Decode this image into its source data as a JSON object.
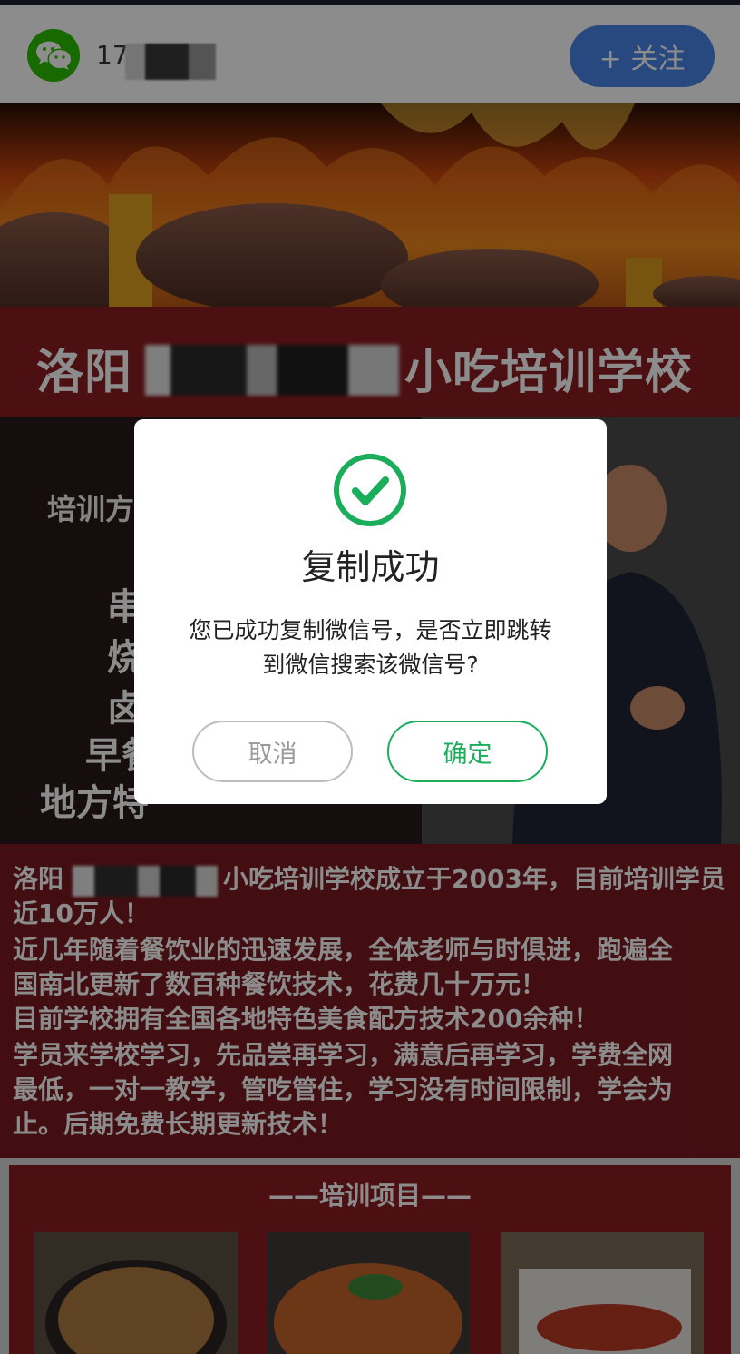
{
  "header": {
    "account_prefix": "17",
    "follow_label": "+ 关注"
  },
  "page": {
    "title_left": "洛阳",
    "title_right": "小吃培训学校",
    "mid_label": "培训方",
    "mid_lines": [
      "串",
      "烧",
      "卤",
      "早餐",
      "地方特"
    ],
    "description": [
      {
        "text_left": "洛阳",
        "text_right": "小吃培训学校成立于2003年，目前培训学员"
      },
      {
        "text": "近10万人！"
      },
      {
        "text": "近几年随着餐饮业的迅速发展，全体老师与时俱进，跑遍全"
      },
      {
        "text": "国南北更新了数百种餐饮技术，花费几十万元！"
      },
      {
        "text": "目前学校拥有全国各地特色美食配方技术200余种！"
      },
      {
        "text": "学员来学校学习，先品尝再学习，满意后再学习，学费全网"
      },
      {
        "text": "最低，一对一教学，管吃管住，学习没有时间限制，学会为"
      },
      {
        "text": "止。后期免费长期更新技术！"
      }
    ],
    "projects_title": "——培训项目——"
  },
  "dialog": {
    "title": "复制成功",
    "message_line1": "您已成功复制微信号，是否立即跳转",
    "message_line2": "到微信搜索该微信号?",
    "cancel_label": "取消",
    "ok_label": "确定"
  },
  "colors": {
    "accent_green": "#1aad5a",
    "follow_blue": "#4a86e8",
    "brand_red": "#8a1d21"
  }
}
